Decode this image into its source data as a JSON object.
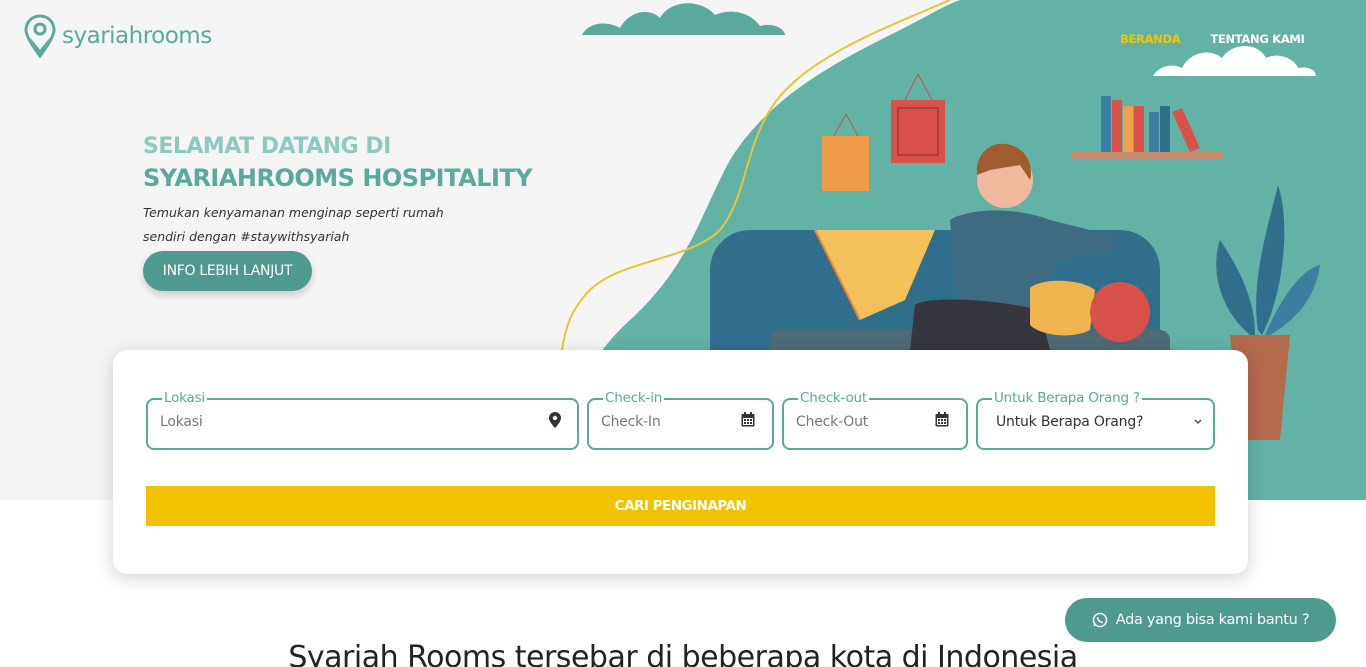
{
  "brand": {
    "name": "syariahrooms"
  },
  "nav": {
    "items": [
      {
        "label": "BERANDA",
        "active": true
      },
      {
        "label": "TENTANG KAMI",
        "active": false
      }
    ]
  },
  "hero": {
    "welcome": "SELAMAT DATANG DI",
    "title": "SYARIAHROOMS HOSPITALITY",
    "tagline": "Temukan kenyamanan menginap seperti rumah sendiri dengan #staywithsyariah",
    "cta_label": "INFO LEBIH LANJUT"
  },
  "search": {
    "lokasi": {
      "legend": "Lokasi",
      "placeholder": "Lokasi",
      "icon": "map-marker-icon"
    },
    "checkin": {
      "legend": "Check-in",
      "placeholder": "Check-In",
      "icon": "calendar-icon"
    },
    "checkout": {
      "legend": "Check-out",
      "placeholder": "Check-Out",
      "icon": "calendar-icon"
    },
    "guests": {
      "legend": "Untuk Berapa Orang ?",
      "selected": "Untuk Berapa Orang?",
      "icon": "chevron-down-icon"
    },
    "submit_label": "CARI PENGINAPAN"
  },
  "help": {
    "label": "Ada yang bisa kami bantu ?",
    "icon": "whatsapp-icon"
  },
  "section": {
    "heading": "Syariah Rooms tersebar di beberapa kota di Indonesia"
  },
  "colors": {
    "primary": "#5aa99d",
    "accent": "#f2c200",
    "hero_bg": "#f5f5f5"
  }
}
